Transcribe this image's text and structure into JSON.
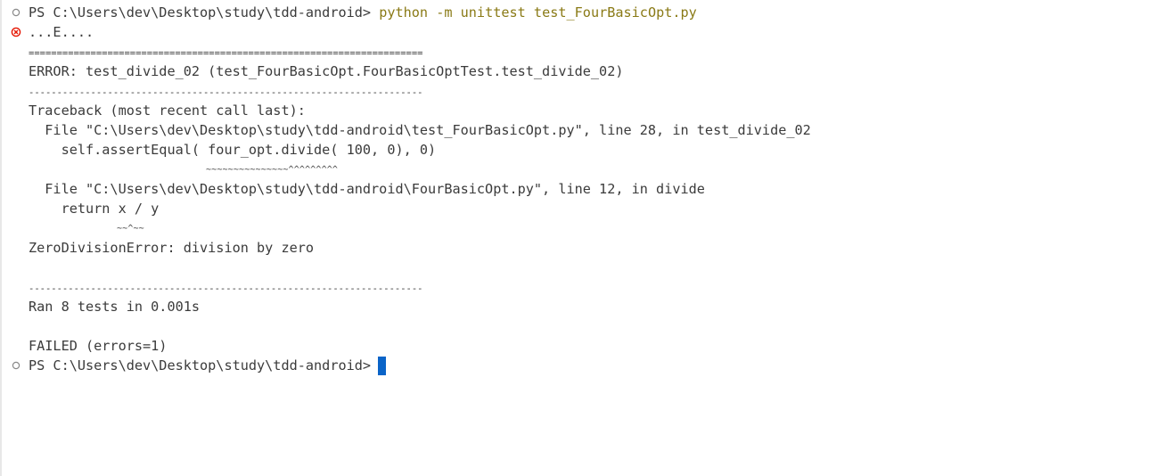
{
  "terminal": {
    "prompt_1": "PS C:\\Users\\dev\\Desktop\\study\\tdd-android>",
    "command": "python -m unittest test_FourBasicOpt.py",
    "progress": "...E....",
    "separator_equals": "======================================================================",
    "error_header": "ERROR: test_divide_02 (test_FourBasicOpt.FourBasicOptTest.test_divide_02)",
    "separator_dashes_1": "----------------------------------------------------------------------",
    "traceback_header": "Traceback (most recent call last):",
    "frame_1": "  File \"C:\\Users\\dev\\Desktop\\study\\tdd-android\\test_FourBasicOpt.py\", line 28, in test_divide_02",
    "frame_1_code": "    self.assertEqual( four_opt.divide( 100, 0), 0)",
    "frame_1_marker": "~~~~~~~~~~~~~~~^^^^^^^^^",
    "frame_2": "  File \"C:\\Users\\dev\\Desktop\\study\\tdd-android\\FourBasicOpt.py\", line 12, in divide",
    "frame_2_code": "    return x / y",
    "frame_2_marker": "~~^~~",
    "exception": "ZeroDivisionError: division by zero",
    "separator_dashes_2": "----------------------------------------------------------------------",
    "ran_summary": "Ran 8 tests in 0.001s",
    "result": "FAILED (errors=1)",
    "prompt_2": "PS C:\\Users\\dev\\Desktop\\study\\tdd-android>"
  },
  "icons": {
    "command_success": "circle-outline-icon",
    "command_error": "error-circle-icon",
    "command_pending": "circle-outline-icon"
  },
  "colors": {
    "command_text": "#8a7a16",
    "error_icon": "#e51400",
    "cursor": "#0a64c8",
    "text": "#3b3b3b"
  }
}
